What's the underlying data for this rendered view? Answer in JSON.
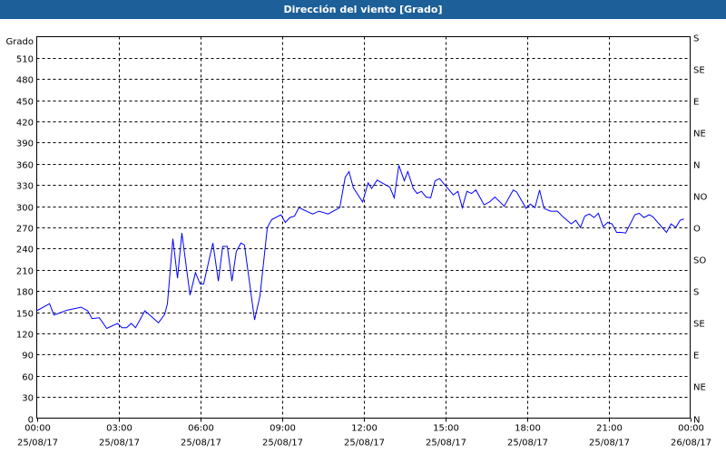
{
  "chart_data": {
    "type": "line",
    "title": "Dirección del viento [Grado]",
    "ylabel": "Grado",
    "xlabel": "",
    "ylim": [
      0,
      540
    ],
    "xlim_hours": [
      0,
      24
    ],
    "grid": true,
    "line_color": "#0000ff",
    "y_ticks": [
      0,
      30,
      60,
      90,
      120,
      150,
      180,
      210,
      240,
      270,
      300,
      330,
      360,
      390,
      420,
      450,
      480,
      510
    ],
    "right_ticks": [
      {
        "value": 0,
        "label": "N"
      },
      {
        "value": 45,
        "label": "NE"
      },
      {
        "value": 90,
        "label": "E"
      },
      {
        "value": 135,
        "label": "SE"
      },
      {
        "value": 180,
        "label": "S"
      },
      {
        "value": 225,
        "label": "SO"
      },
      {
        "value": 270,
        "label": "O"
      },
      {
        "value": 315,
        "label": "NO"
      },
      {
        "value": 360,
        "label": "N"
      },
      {
        "value": 405,
        "label": "NE"
      },
      {
        "value": 450,
        "label": "E"
      },
      {
        "value": 495,
        "label": "SE"
      },
      {
        "value": 540,
        "label": "S"
      }
    ],
    "x_ticks": [
      {
        "hour": 0,
        "time": "00:00",
        "date": "25/08/17"
      },
      {
        "hour": 3,
        "time": "03:00",
        "date": "25/08/17"
      },
      {
        "hour": 6,
        "time": "06:00",
        "date": "25/08/17"
      },
      {
        "hour": 9,
        "time": "09:00",
        "date": "25/08/17"
      },
      {
        "hour": 12,
        "time": "12:00",
        "date": "25/08/17"
      },
      {
        "hour": 15,
        "time": "15:00",
        "date": "25/08/17"
      },
      {
        "hour": 18,
        "time": "18:00",
        "date": "25/08/17"
      },
      {
        "hour": 21,
        "time": "21:00",
        "date": "25/08/17"
      },
      {
        "hour": 24,
        "time": "00:00",
        "date": "26/08/17"
      }
    ],
    "series": [
      {
        "name": "Dirección del viento",
        "points": [
          [
            0,
            152
          ],
          [
            0.47,
            162
          ],
          [
            0.63,
            146
          ],
          [
            1.13,
            153
          ],
          [
            1.63,
            157
          ],
          [
            1.87,
            152
          ],
          [
            2.03,
            141
          ],
          [
            2.3,
            142
          ],
          [
            2.57,
            127
          ],
          [
            2.97,
            134
          ],
          [
            3.13,
            128
          ],
          [
            3.3,
            128
          ],
          [
            3.47,
            134
          ],
          [
            3.63,
            128
          ],
          [
            3.97,
            152
          ],
          [
            4.47,
            135
          ],
          [
            4.7,
            147
          ],
          [
            4.8,
            162
          ],
          [
            5.0,
            254
          ],
          [
            5.17,
            198
          ],
          [
            5.33,
            262
          ],
          [
            5.63,
            174
          ],
          [
            5.83,
            206
          ],
          [
            6.0,
            190
          ],
          [
            6.13,
            190
          ],
          [
            6.47,
            248
          ],
          [
            6.67,
            194
          ],
          [
            6.83,
            243
          ],
          [
            7.0,
            243
          ],
          [
            7.17,
            194
          ],
          [
            7.33,
            236
          ],
          [
            7.5,
            248
          ],
          [
            7.63,
            245
          ],
          [
            8.0,
            139
          ],
          [
            8.2,
            173
          ],
          [
            8.47,
            270
          ],
          [
            8.63,
            281
          ],
          [
            8.97,
            288
          ],
          [
            9.13,
            277
          ],
          [
            9.3,
            284
          ],
          [
            9.47,
            286
          ],
          [
            9.63,
            298
          ],
          [
            10.13,
            289
          ],
          [
            10.37,
            293
          ],
          [
            10.7,
            289
          ],
          [
            11.13,
            298
          ],
          [
            11.33,
            341
          ],
          [
            11.47,
            349
          ],
          [
            11.63,
            326
          ],
          [
            11.97,
            306
          ],
          [
            12.17,
            333
          ],
          [
            12.3,
            325
          ],
          [
            12.5,
            337
          ],
          [
            12.97,
            327
          ],
          [
            13.13,
            312
          ],
          [
            13.3,
            358
          ],
          [
            13.5,
            336
          ],
          [
            13.63,
            349
          ],
          [
            13.83,
            325
          ],
          [
            13.97,
            318
          ],
          [
            14.13,
            321
          ],
          [
            14.3,
            313
          ],
          [
            14.47,
            312
          ],
          [
            14.63,
            336
          ],
          [
            14.8,
            339
          ],
          [
            14.97,
            331
          ],
          [
            15.3,
            316
          ],
          [
            15.47,
            321
          ],
          [
            15.63,
            298
          ],
          [
            15.8,
            321
          ],
          [
            15.97,
            318
          ],
          [
            16.13,
            323
          ],
          [
            16.43,
            302
          ],
          [
            16.63,
            306
          ],
          [
            16.83,
            313
          ],
          [
            17.17,
            300
          ],
          [
            17.5,
            323
          ],
          [
            17.63,
            320
          ],
          [
            17.97,
            297
          ],
          [
            18.13,
            303
          ],
          [
            18.3,
            298
          ],
          [
            18.47,
            323
          ],
          [
            18.63,
            297
          ],
          [
            18.87,
            293
          ],
          [
            19.13,
            293
          ],
          [
            19.3,
            286
          ],
          [
            19.63,
            275
          ],
          [
            19.8,
            280
          ],
          [
            19.97,
            270
          ],
          [
            20.13,
            286
          ],
          [
            20.3,
            289
          ],
          [
            20.47,
            284
          ],
          [
            20.63,
            290
          ],
          [
            20.8,
            271
          ],
          [
            20.97,
            277
          ],
          [
            21.13,
            275
          ],
          [
            21.3,
            263
          ],
          [
            21.47,
            263
          ],
          [
            21.63,
            262
          ],
          [
            21.97,
            288
          ],
          [
            22.13,
            290
          ],
          [
            22.3,
            284
          ],
          [
            22.5,
            288
          ],
          [
            22.63,
            285
          ],
          [
            23.13,
            263
          ],
          [
            23.3,
            275
          ],
          [
            23.47,
            270
          ],
          [
            23.63,
            280
          ],
          [
            23.77,
            282
          ]
        ]
      }
    ]
  }
}
